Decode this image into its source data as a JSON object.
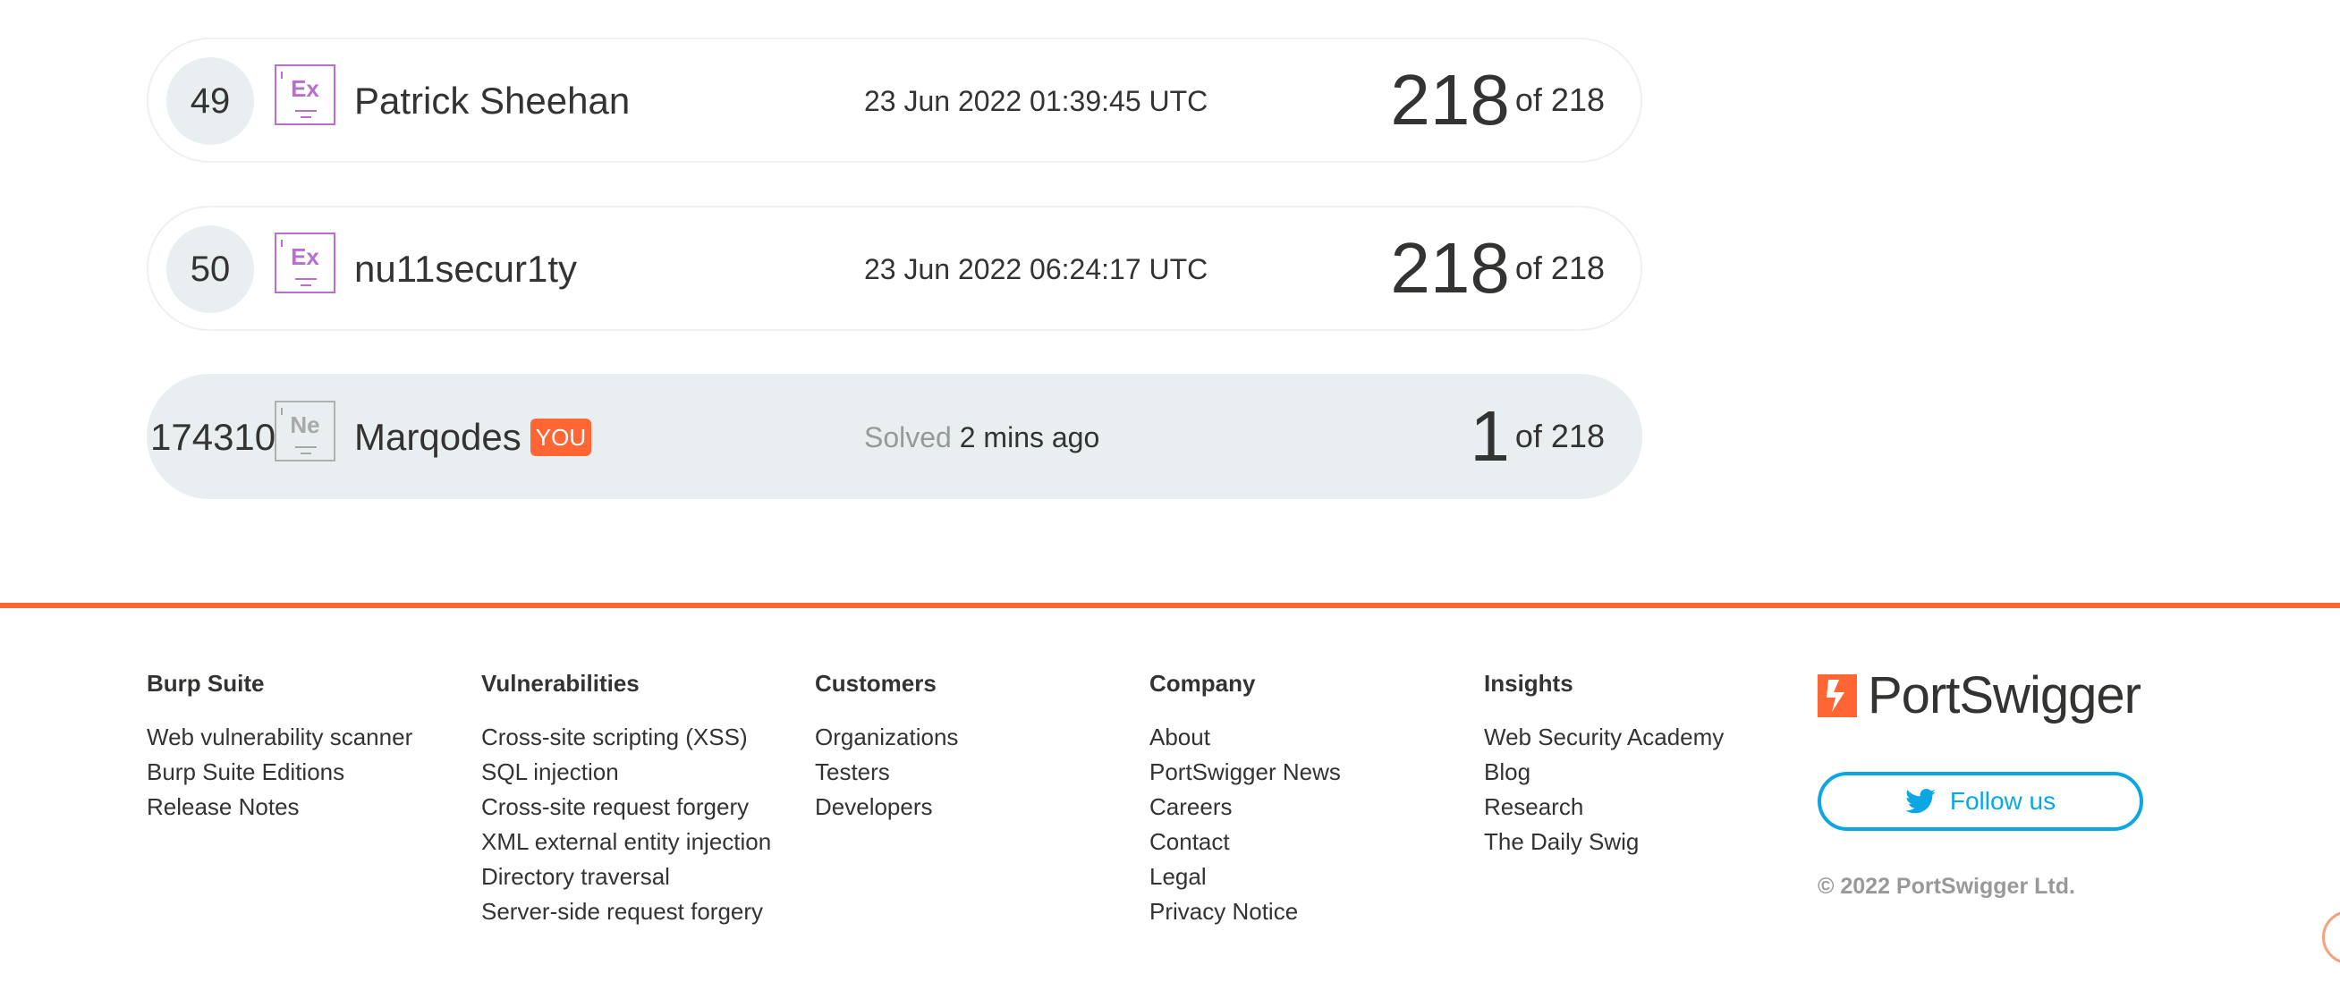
{
  "leaderboard": {
    "rows": [
      {
        "rank": "49",
        "badge": "Ex",
        "name": "Patrick Sheehan",
        "time": "23 Jun 2022 01:39:45 UTC",
        "score": "218",
        "of": "of 218"
      },
      {
        "rank": "50",
        "badge": "Ex",
        "name": "nu11secur1ty",
        "time": "23 Jun 2022 06:24:17 UTC",
        "score": "218",
        "of": "of 218"
      }
    ],
    "me": {
      "rank": "174310",
      "badge": "Ne",
      "name": "Marqodes",
      "you": "YOU",
      "solved_label": "Solved",
      "solved_when": "2 mins ago",
      "score": "1",
      "of": "of 218"
    }
  },
  "footer": {
    "columns": [
      {
        "heading": "Burp Suite",
        "links": [
          "Web vulnerability scanner",
          "Burp Suite Editions",
          "Release Notes"
        ]
      },
      {
        "heading": "Vulnerabilities",
        "links": [
          "Cross-site scripting (XSS)",
          "SQL injection",
          "Cross-site request forgery",
          "XML external entity injection",
          "Directory traversal",
          "Server-side request forgery"
        ]
      },
      {
        "heading": "Customers",
        "links": [
          "Organizations",
          "Testers",
          "Developers"
        ]
      },
      {
        "heading": "Company",
        "links": [
          "About",
          "PortSwigger News",
          "Careers",
          "Contact",
          "Legal",
          "Privacy Notice"
        ]
      },
      {
        "heading": "Insights",
        "links": [
          "Web Security Academy",
          "Blog",
          "Research",
          "The Daily Swig"
        ]
      }
    ],
    "logo_text": "PortSwigger",
    "follow_label": "Follow us",
    "copyright": "© 2022 PortSwigger Ltd."
  },
  "colors": {
    "accent": "#ff6633",
    "twitter": "#0aa7e4",
    "expert_badge": "#b96ecd",
    "novice_badge": "#a8a8a8"
  },
  "icons": [
    "portswigger-logo-icon",
    "twitter-bird-icon",
    "scroll-top-icon"
  ]
}
